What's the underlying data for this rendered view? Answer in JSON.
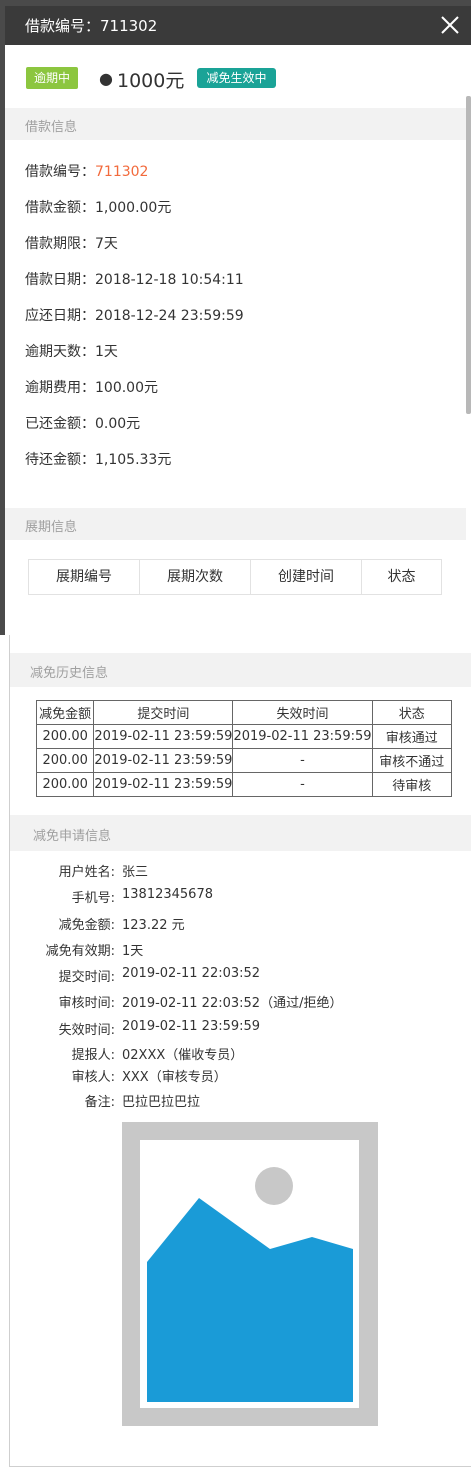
{
  "header": {
    "title": "借款编号：711302"
  },
  "summary": {
    "status_tag": "逾期中",
    "amount": "1000元",
    "relief_tag": "减免生效中"
  },
  "loan_info": {
    "section_title": "借款信息",
    "rows": [
      {
        "label": "借款编号：",
        "value": "711302"
      },
      {
        "label": "借款金额：",
        "value": "1,000.00元"
      },
      {
        "label": "借款期限：",
        "value": "7天"
      },
      {
        "label": "借款日期：",
        "value": "2018-12-18 10:54:11"
      },
      {
        "label": "应还日期：",
        "value": "2018-12-24 23:59:59"
      },
      {
        "label": "逾期天数：",
        "value": "1天"
      },
      {
        "label": "逾期费用：",
        "value": "100.00元"
      },
      {
        "label": "已还金额：",
        "value": "0.00元"
      },
      {
        "label": "待还金额：",
        "value": "1,105.33元"
      }
    ]
  },
  "extension_info": {
    "section_title": "展期信息",
    "columns": [
      "展期编号",
      "展期次数",
      "创建时间",
      "状态"
    ]
  },
  "relief_history": {
    "section_title": "减免历史信息",
    "columns": [
      "减免金额",
      "提交时间",
      "失效时间",
      "状态"
    ],
    "rows": [
      [
        "200.00",
        "2019-02-11 23:59:59",
        "2019-02-11 23:59:59",
        "审核通过"
      ],
      [
        "200.00",
        "2019-02-11 23:59:59",
        "-",
        "审核不通过"
      ],
      [
        "200.00",
        "2019-02-11 23:59:59",
        "-",
        "待审核"
      ]
    ]
  },
  "relief_application": {
    "section_title": "减免申请信息",
    "fields": [
      {
        "label": "用户姓名:",
        "value": "张三"
      },
      {
        "label": "手机号:",
        "value": "13812345678"
      },
      {
        "label": "减免金额:",
        "value": "123.22 元"
      },
      {
        "label": "减免有效期:",
        "value": "1天"
      },
      {
        "label": "提交时间:",
        "value": "2019-02-11 22:03:52"
      },
      {
        "label": "审核时间:",
        "value": "2019-02-11 22:03:52（通过/拒绝）"
      },
      {
        "label": "失效时间:",
        "value": "2019-02-11 23:59:59"
      },
      {
        "label": "提报人:",
        "value": "02XXX（催收专员）"
      },
      {
        "label": "审核人:",
        "value": "XXX（审核专员）"
      },
      {
        "label": "备注:",
        "value": "巴拉巴拉巴拉"
      }
    ],
    "attachment_icon": "image-placeholder-icon"
  },
  "colors": {
    "header_bg": "#3a3a3a",
    "overdue_tag": "#8cc63f",
    "relief_tag": "#1aa397",
    "accent_text": "#f26a3c",
    "section_bg": "#f2f2f2",
    "placeholder_sky": "#ffffff",
    "placeholder_mountain": "#1a9bd7"
  }
}
